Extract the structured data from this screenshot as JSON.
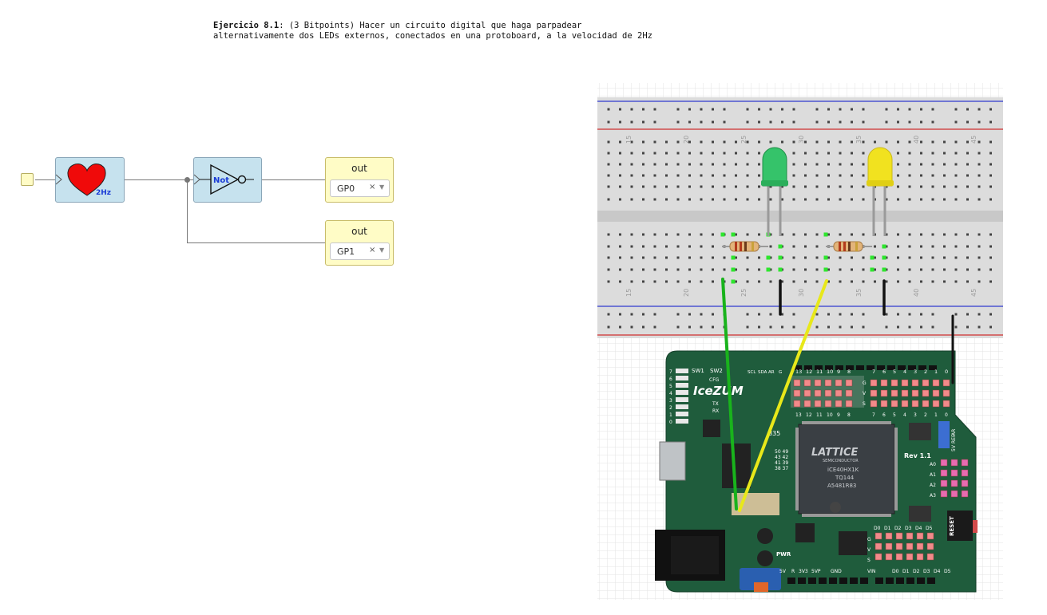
{
  "header": {
    "title_bold": "Ejercicio 8.1",
    "title_line1_rest": ": (3 Bitpoints) Hacer un circuito digital que haga parpadear",
    "title_line2": "alternativamente dos LEDs externos, conectados en una protoboard, a la velocidad de 2Hz"
  },
  "circuit": {
    "heart_block": {
      "label": "2Hz",
      "icon": "heart-icon"
    },
    "not_block": {
      "label": "Not"
    },
    "outputs": [
      {
        "title": "out",
        "pin": "GP0"
      },
      {
        "title": "out",
        "pin": "GP1"
      }
    ],
    "clear_glyph": "×"
  },
  "breadboard": {
    "column_numbers": [
      "15",
      "20",
      "25",
      "30",
      "35",
      "40",
      "45"
    ],
    "led_colors": {
      "green": "#35c36a",
      "yellow": "#f1e21f"
    },
    "wire_colors": {
      "green": "#19b31c",
      "yellow": "#e8e81a",
      "black": "#111111"
    }
  },
  "board": {
    "name": "IceZUM",
    "chip_brand": "LATTICE",
    "chip_sub": "SEMICONDUCTOR",
    "chip_model": "iCE40HX1K",
    "chip_pkg": "TQ144",
    "chip_code": "A5481R83",
    "revision": "Rev 1.1",
    "reset_label": "RESET",
    "pwr_label": "PWR",
    "sw_labels": [
      "SW1",
      "SW2"
    ],
    "cfg_label": "CFG",
    "tx_label": "TX",
    "rx_label": "RX",
    "top_header_left": [
      "SCL",
      "SDA",
      "AR",
      "G"
    ],
    "top_header_nums": [
      "13",
      "12",
      "11",
      "10",
      "9",
      "8"
    ],
    "top_header_nums2": [
      "7",
      "6",
      "5",
      "4",
      "3",
      "2",
      "1",
      "0"
    ],
    "gvs": [
      "G",
      "V",
      "S"
    ],
    "analog_labels": [
      "A0",
      "A1",
      "A2",
      "A3"
    ],
    "bottom_d_labels": [
      "D0",
      "D1",
      "D2",
      "D3",
      "D4",
      "D5"
    ],
    "power_labels": [
      "5V",
      "R",
      "3V3",
      "5VP",
      "GND",
      "VIN"
    ],
    "led_row_nums": [
      "7",
      "6",
      "5",
      "4",
      "3",
      "2",
      "1",
      "0"
    ],
    "misc_num": "835",
    "pin_table": [
      "50 49",
      "43 42",
      "41 39",
      "38 37"
    ],
    "vertical_labels": [
      "5V",
      "REF",
      "AR"
    ]
  }
}
